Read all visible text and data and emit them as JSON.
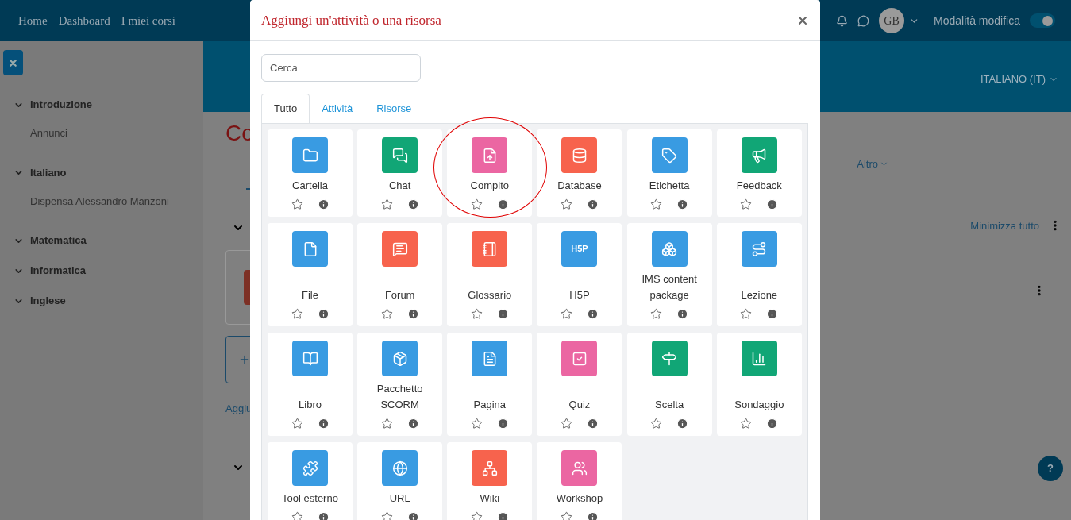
{
  "navbar": {
    "links": [
      "Home",
      "Dashboard",
      "I miei corsi"
    ],
    "avatar": "GB",
    "edit_mode": {
      "label": "Modalità modifica",
      "on": true
    }
  },
  "sidebar": {
    "sections": [
      {
        "title": "Introduzione",
        "expanded": true,
        "items": [
          "Annunci"
        ]
      },
      {
        "title": "Italiano",
        "expanded": true,
        "items": [
          "Dispensa Alessandro Manzoni"
        ]
      },
      {
        "title": "Matematica",
        "expanded": true
      },
      {
        "title": "Informatica",
        "expanded": true
      },
      {
        "title": "Inglese",
        "expanded": true
      }
    ]
  },
  "course": {
    "language": "ITALIANO (IT)",
    "title": "Co",
    "more": "Altro",
    "collapse_all": "Minimizza tutto",
    "add_link": "Aggiu",
    "help": "?"
  },
  "modal": {
    "title": "Aggiungi un'attività o una risorsa",
    "search": {
      "placeholder": "Cerca"
    },
    "tabs": [
      {
        "label": "Tutto",
        "selected": true
      },
      {
        "label": "Attività",
        "selected": false
      },
      {
        "label": "Risorse",
        "selected": false
      }
    ],
    "items": [
      {
        "name": "Cartella",
        "color": "#399be2",
        "starred": false,
        "circled": false
      },
      {
        "name": "Chat",
        "color": "#11a676",
        "starred": false,
        "circled": false
      },
      {
        "name": "Compito",
        "color": "#eb66a2",
        "starred": false,
        "circled": true
      },
      {
        "name": "Database",
        "color": "#f7634d",
        "starred": false,
        "circled": false
      },
      {
        "name": "Etichetta",
        "color": "#399be2",
        "starred": false,
        "circled": false
      },
      {
        "name": "Feedback",
        "color": "#11a676",
        "starred": false,
        "circled": false
      },
      {
        "name": "File",
        "color": "#399be2",
        "starred": false,
        "circled": false
      },
      {
        "name": "Forum",
        "color": "#f7634d",
        "starred": false,
        "circled": false
      },
      {
        "name": "Glossario",
        "color": "#f7634d",
        "starred": false,
        "circled": false
      },
      {
        "name": "H5P",
        "color": "#399be2",
        "starred": false,
        "circled": false,
        "logo": "H5P"
      },
      {
        "name": "IMS content package",
        "color": "#399be2",
        "starred": false,
        "circled": false
      },
      {
        "name": "Lezione",
        "color": "#399be2",
        "starred": false,
        "circled": false
      },
      {
        "name": "Libro",
        "color": "#399be2",
        "starred": false,
        "circled": false
      },
      {
        "name": "Pacchetto SCORM",
        "color": "#399be2",
        "starred": false,
        "circled": false
      },
      {
        "name": "Pagina",
        "color": "#399be2",
        "starred": false,
        "circled": false
      },
      {
        "name": "Quiz",
        "color": "#eb66a2",
        "starred": false,
        "circled": false
      },
      {
        "name": "Scelta",
        "color": "#11a676",
        "starred": false,
        "circled": false
      },
      {
        "name": "Sondaggio",
        "color": "#11a676",
        "starred": false,
        "circled": false
      },
      {
        "name": "Tool esterno",
        "color": "#399be2",
        "starred": false,
        "circled": false
      },
      {
        "name": "URL",
        "color": "#399be2",
        "starred": false,
        "circled": false
      },
      {
        "name": "Wiki",
        "color": "#f7634d",
        "starred": false,
        "circled": false
      },
      {
        "name": "Workshop",
        "color": "#eb66a2",
        "starred": false,
        "circled": false
      }
    ]
  }
}
